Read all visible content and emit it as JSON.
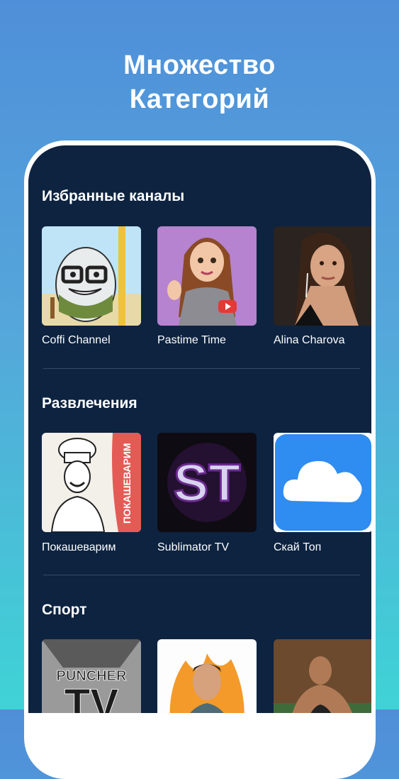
{
  "headline": {
    "line1": "Множество",
    "line2": "Категорий"
  },
  "sections": [
    {
      "title": "Избранные каналы",
      "channels": [
        {
          "name": "Coffi Channel",
          "icon": "cartoon-coffee-cup-icon"
        },
        {
          "name": "Pastime Time",
          "icon": "cartoon-girl-youtube-icon"
        },
        {
          "name": "Alina Charova",
          "icon": "woman-portrait-photo"
        }
      ]
    },
    {
      "title": "Развлечения",
      "channels": [
        {
          "name": "Покашеварим",
          "icon": "chef-sketch-icon",
          "badge": "ПОКАШЕВАРИМ"
        },
        {
          "name": "Sublimator TV",
          "icon": "st-logo-icon",
          "logo_text": "ST"
        },
        {
          "name": "Скай Топ",
          "icon": "cloud-icon"
        }
      ]
    },
    {
      "title": "Спорт",
      "channels": [
        {
          "name": "",
          "icon": "puncher-tv-logo",
          "logo_text_top": "PUNCHER",
          "logo_text_bottom": "TV"
        },
        {
          "name": "",
          "icon": "man-portrait-fire-photo"
        },
        {
          "name": "",
          "icon": "bodybuilder-gym-photo"
        }
      ]
    }
  ],
  "colors": {
    "screen_bg": "#0d2340",
    "accent_red": "#e45b55",
    "cloud_blue": "#2f8cf0"
  }
}
